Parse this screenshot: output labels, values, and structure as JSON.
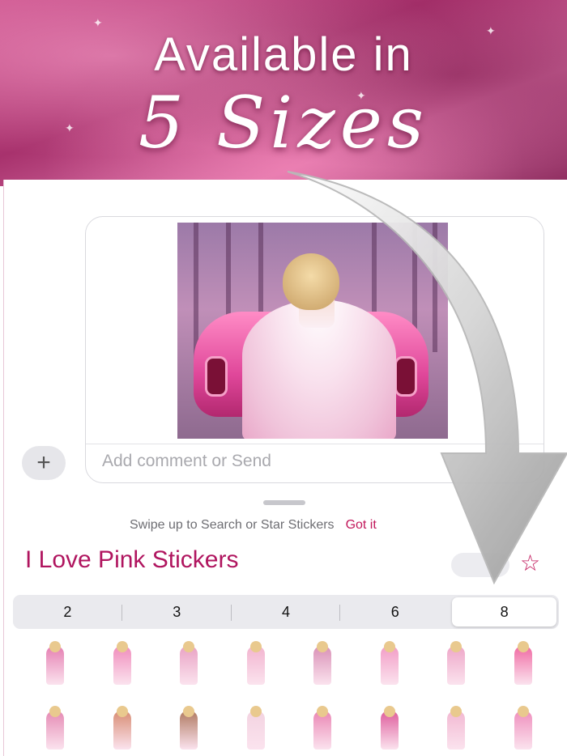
{
  "banner": {
    "line1": "Available in",
    "line2": "5 Sizes"
  },
  "compose": {
    "placeholder": "Add comment or Send",
    "plus_icon": "+",
    "close_icon": "×"
  },
  "drawer": {
    "hint": "Swipe up to Search or Star Stickers",
    "hint_link": "Got it",
    "pack_title": "I Love Pink Stickers",
    "star_icon": "☆"
  },
  "sizes": {
    "options": [
      "2",
      "3",
      "4",
      "6",
      "8"
    ],
    "selected": "8"
  },
  "stickers": [
    {
      "icon": "pink-car-bride-sticker",
      "color": "#e57fb2"
    },
    {
      "icon": "car-with-balloons-sticker",
      "color": "#f08cbc"
    },
    {
      "icon": "girl-with-dog-sticker",
      "color": "#e9a2c4"
    },
    {
      "icon": "girl-with-puppy-sticker",
      "color": "#f2b4cf"
    },
    {
      "icon": "couple-wedding-sticker",
      "color": "#d990b6"
    },
    {
      "icon": "pink-gown-sticker",
      "color": "#f29cc6"
    },
    {
      "icon": "ball-gown-sticker",
      "color": "#eea6c8"
    },
    {
      "icon": "baker-girl-sticker",
      "color": "#f06aa3"
    },
    {
      "icon": "fitness-girl-sticker",
      "color": "#e58ab4"
    },
    {
      "icon": "girl-with-bear-sticker",
      "color": "#d88d74"
    },
    {
      "icon": "cowgirl-horse-sticker",
      "color": "#b07a62"
    },
    {
      "icon": "bride-veil-sticker",
      "color": "#f3d3e1"
    },
    {
      "icon": "pink-jacket-girl-sticker",
      "color": "#ea86b4"
    },
    {
      "icon": "pink-pantsuit-sticker",
      "color": "#de5c9c"
    },
    {
      "icon": "tennis-girl-sticker",
      "color": "#f2b8d2"
    },
    {
      "icon": "pink-outfit-girl-sticker",
      "color": "#ef8fbd"
    }
  ]
}
